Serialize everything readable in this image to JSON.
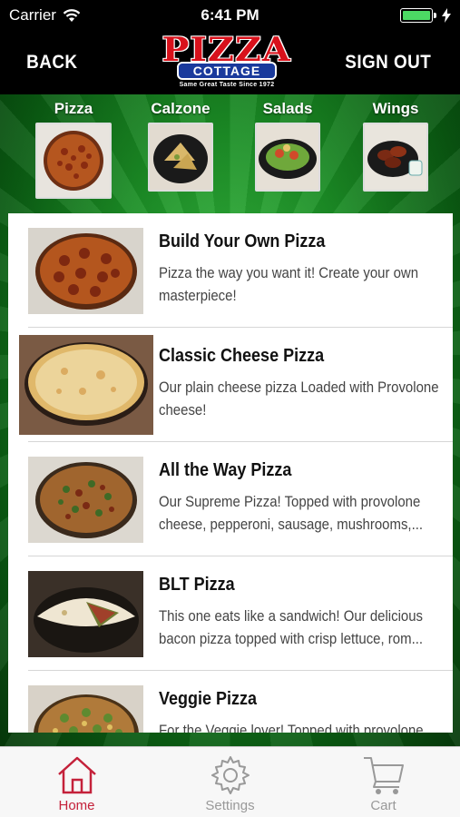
{
  "status": {
    "carrier": "Carrier",
    "time": "6:41 PM"
  },
  "nav": {
    "back_label": "BACK",
    "signout_label": "SIGN OUT",
    "logo_main": "PIZZA",
    "logo_sub": "COTTAGE",
    "logo_tag": "Same Great Taste Since 1972"
  },
  "categories": [
    {
      "label": "Pizza",
      "icon": "pizza-thumb"
    },
    {
      "label": "Calzone",
      "icon": "calzone-thumb"
    },
    {
      "label": "Salads",
      "icon": "salad-thumb"
    },
    {
      "label": "Wings",
      "icon": "wings-thumb"
    }
  ],
  "menu_items": [
    {
      "title": "Build Your Own Pizza",
      "desc": "Pizza the way you want it! Create your own masterpiece!"
    },
    {
      "title": "Classic Cheese Pizza",
      "desc": "Our plain cheese pizza Loaded with Provolone cheese!"
    },
    {
      "title": "All the Way Pizza",
      "desc": "Our Supreme Pizza! Topped with provolone cheese, pepperoni, sausage, mushrooms,..."
    },
    {
      "title": "BLT Pizza",
      "desc": "This one eats like a sandwich! Our delicious bacon pizza topped with crisp lettuce, rom..."
    },
    {
      "title": "Veggie Pizza",
      "desc": "For the Veggie lover! Topped with provolone"
    }
  ],
  "tabs": [
    {
      "label": "Home",
      "icon": "home-icon",
      "active": true
    },
    {
      "label": "Settings",
      "icon": "gear-icon",
      "active": false
    },
    {
      "label": "Cart",
      "icon": "cart-icon",
      "active": false
    }
  ],
  "colors": {
    "accent": "#c4213a",
    "battery": "#4cd964",
    "logo_red": "#d8111b",
    "logo_blue": "#1a3a9c"
  }
}
